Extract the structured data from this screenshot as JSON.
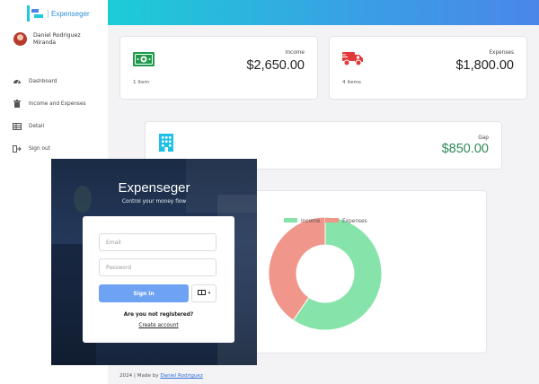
{
  "brand": {
    "name": "Expenseger"
  },
  "user": {
    "name": "Daniel Rodriguez Miranda"
  },
  "nav": {
    "items": [
      {
        "label": "Dashboard",
        "icon": "gauge-icon"
      },
      {
        "label": "Income and Expenses",
        "icon": "trash-icon"
      },
      {
        "label": "Detail",
        "icon": "table-icon"
      },
      {
        "label": "Sign out",
        "icon": "sign-out-icon"
      }
    ]
  },
  "cards": {
    "income": {
      "label": "Income",
      "value": "$2,650.00",
      "note": "1 item",
      "icon": "money-icon",
      "color": "#1e9a4a"
    },
    "expenses": {
      "label": "Expenses",
      "value": "$1,800.00",
      "note": "4 items",
      "icon": "truck-icon",
      "color": "#e23a3a"
    },
    "gap": {
      "label": "Gap",
      "value": "$850.00",
      "icon": "building-icon",
      "color": "#2e8a57",
      "icon_color": "#1ec0e8"
    }
  },
  "chart_data": {
    "type": "pie",
    "donut": true,
    "categories": [
      "Income",
      "Expenses"
    ],
    "values": [
      2650,
      1800
    ],
    "colors": [
      "#86e3a9",
      "#f1968a"
    ],
    "legend_position": "top"
  },
  "login": {
    "title": "Expenseger",
    "subtitle": "Control your money flow",
    "email_placeholder": "Email",
    "password_placeholder": "Password",
    "signin_label": "Sign in",
    "lang_label": "▾",
    "register_question": "Are you not registered?",
    "register_link": "Create account"
  },
  "footer": {
    "prefix": "2024 | Made by",
    "author": "Daniel Rodriguez"
  }
}
